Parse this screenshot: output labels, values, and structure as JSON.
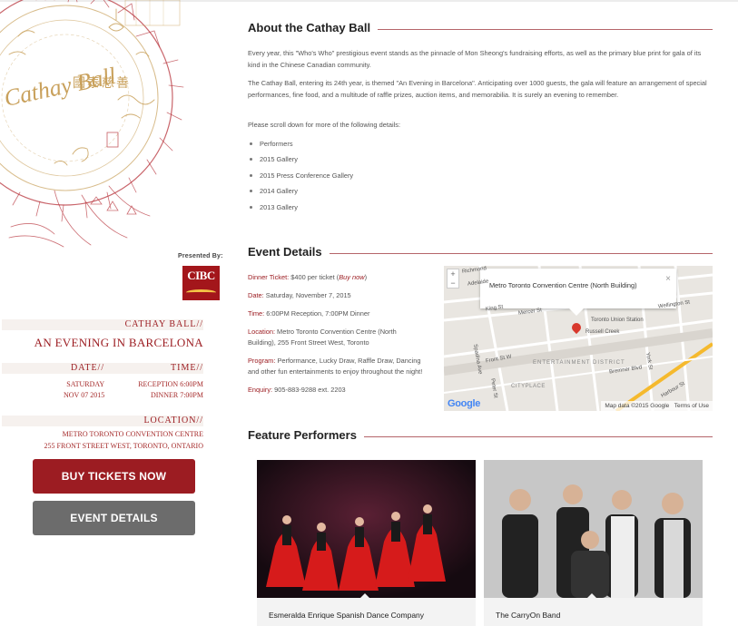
{
  "emblem": {
    "logo_text": "Cathay Ball",
    "chinese": "國泰慈善"
  },
  "sponsor": {
    "presented_by": "Presented By:",
    "logo": "CIBC"
  },
  "infobox": {
    "title": "CATHAY BALL//",
    "subtitle": "AN EVENING IN BARCELONA",
    "date_label": "DATE//",
    "time_label": "TIME//",
    "day": "SATURDAY",
    "date": "NOV 07 2015",
    "reception": "RECEPTION 6:00PM",
    "dinner": "DINNER 7:00PM",
    "location_label": "LOCATION//",
    "venue": "METRO TORONTO CONVENTION CENTRE",
    "address": "255 FRONT STREET WEST, TORONTO, ONTARIO"
  },
  "buttons": {
    "buy": "BUY TICKETS NOW",
    "details": "EVENT DETAILS"
  },
  "about": {
    "heading": "About the Cathay Ball",
    "p1": "Every year, this \"Who's Who\" prestigious event stands as the pinnacle of Mon Sheong's fundraising efforts, as well as the primary blue print for gala of its kind in the Chinese Canadian community.",
    "p2": "The Cathay Ball, entering its 24th year, is themed \"An Evening in Barcelona\". Anticipating over 1000 guests, the gala will feature an arrangement of special performances, fine food, and a multitude of raffle prizes, auction items, and memorabilia. It is surely an evening to remember.",
    "p3": "Please scroll down for more of the following details:",
    "list": [
      "Performers",
      "2015 Gallery",
      "2015 Press Conference Gallery",
      "2014 Gallery",
      "2013 Gallery"
    ]
  },
  "event": {
    "heading": "Event Details",
    "ticket_label": "Dinner Ticket:",
    "ticket_value": " $400 per ticket (",
    "ticket_link": "Buy now",
    "ticket_end": ")",
    "date_label": "Date:",
    "date_value": " Saturday, November 7, 2015",
    "time_label": "Time:",
    "time_value": " 6:00PM Reception, 7:00PM Dinner",
    "location_label": "Location:",
    "location_value": " Metro Toronto Convention Centre (North Building), 255 Front Street West, Toronto",
    "program_label": "Program:",
    "program_value": " Performance, Lucky Draw, Raffle Draw, Dancing and other fun entertainments to enjoy throughout the night!",
    "enquiry_label": "Enquiry:",
    "enquiry_value": " 905-883-9288 ext. 2203"
  },
  "map": {
    "bubble": "Metro Toronto Convention Centre (North Building)",
    "zoom_in": "+",
    "zoom_out": "−",
    "labels": {
      "station": "Toronto Union Station",
      "creek": "Russell Creek",
      "district": "ENTERTAINMENT DISTRICT",
      "cityplace": "CITYPLACE",
      "king": "King St",
      "mercer": "Mercer St",
      "front": "Front St W",
      "bremner": "Bremner Blvd",
      "york": "York St",
      "spadina": "Spadina Ave",
      "adelaide": "Adelaide",
      "richmond": "Richmond",
      "wellington": "Wellington St",
      "peter": "Peter St",
      "harbour": "Harbour St"
    },
    "footer_data": "Map data ©2015 Google",
    "footer_terms": "Terms of Use",
    "google": "Google"
  },
  "performers": {
    "heading": "Feature Performers",
    "cards": [
      {
        "caption": "Esmeralda Enrique Spanish Dance Company"
      },
      {
        "caption": "The CarryOn Band"
      }
    ]
  },
  "colors": {
    "accent": "#9c1c22",
    "grey_button": "#6c6c6c",
    "rule": "#b5656a"
  }
}
